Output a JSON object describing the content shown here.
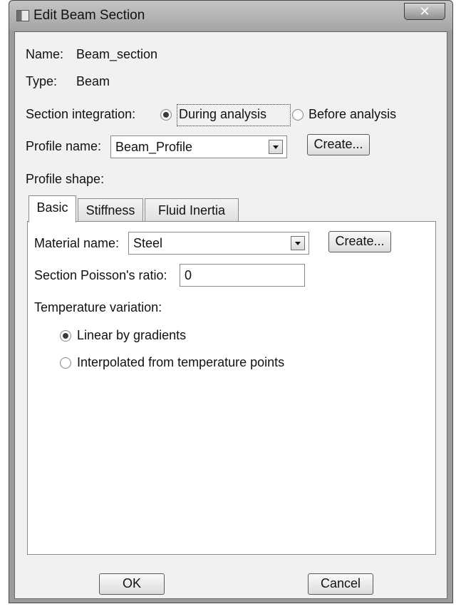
{
  "window": {
    "title": "Edit Beam Section",
    "close_glyph": "✕"
  },
  "info": {
    "name_label": "Name:",
    "name_value": "Beam_section",
    "type_label": "Type:",
    "type_value": "Beam"
  },
  "integration": {
    "label": "Section integration:",
    "options": [
      "During analysis",
      "Before analysis"
    ],
    "selected": "During analysis"
  },
  "profile": {
    "name_label": "Profile name:",
    "name_value": "Beam_Profile",
    "create_label": "Create...",
    "shape_label": "Profile shape:"
  },
  "tabs": {
    "items": [
      "Basic",
      "Stiffness",
      "Fluid Inertia"
    ],
    "active": "Basic"
  },
  "basic": {
    "material_label": "Material name:",
    "material_value": "Steel",
    "create_label": "Create...",
    "poisson_label": "Section Poisson's ratio:",
    "poisson_value": "0",
    "temp_label": "Temperature variation:",
    "temp_options": [
      "Linear by gradients",
      "Interpolated from temperature points"
    ],
    "temp_selected": "Linear by gradients"
  },
  "buttons": {
    "ok": "OK",
    "cancel": "Cancel"
  },
  "icons": {
    "app": "window-app-icon",
    "close": "close-icon",
    "dropdown": "chevron-down-icon"
  }
}
